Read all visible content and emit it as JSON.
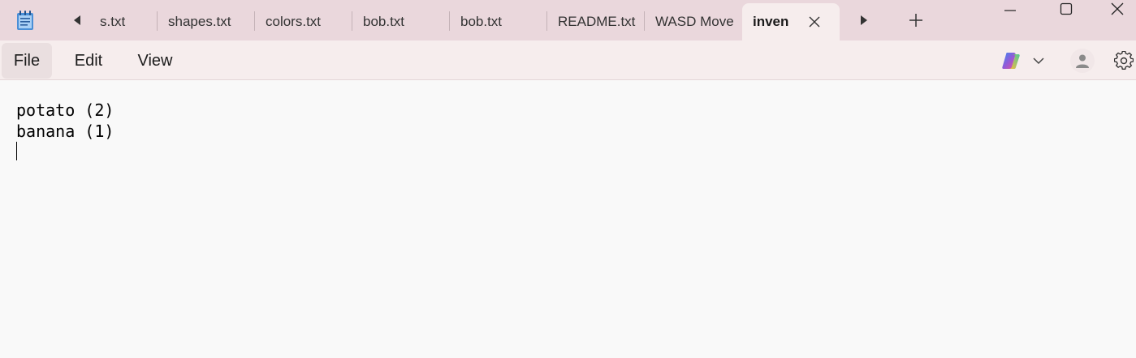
{
  "titlebar": {
    "app_icon": "notepad-icon",
    "tabs": [
      {
        "label": "s.txt"
      },
      {
        "label": "shapes.txt"
      },
      {
        "label": "colors.txt"
      },
      {
        "label": "bob.txt"
      },
      {
        "label": "bob.txt"
      },
      {
        "label": "README.txt"
      },
      {
        "label": "WASD Move"
      },
      {
        "label": "inven",
        "active": true
      }
    ],
    "scroll_left_icon": "caret-left-icon",
    "scroll_right_icon": "caret-right-icon",
    "new_tab_icon": "plus-icon",
    "window_controls": [
      "minimize-icon",
      "maximize-icon",
      "close-icon"
    ]
  },
  "menubar": {
    "items": [
      {
        "label": "File"
      },
      {
        "label": "Edit"
      },
      {
        "label": "View"
      }
    ],
    "right_icons": [
      "copilot-icon",
      "chevron-down-icon",
      "account-icon",
      "gear-icon"
    ]
  },
  "editor": {
    "lines": [
      "potato (2)",
      "banana (1)",
      ""
    ]
  },
  "colors": {
    "titlebar_bg": "#ead7dc",
    "menubar_bg": "#f6eded",
    "editor_bg": "#f9f9f9"
  }
}
